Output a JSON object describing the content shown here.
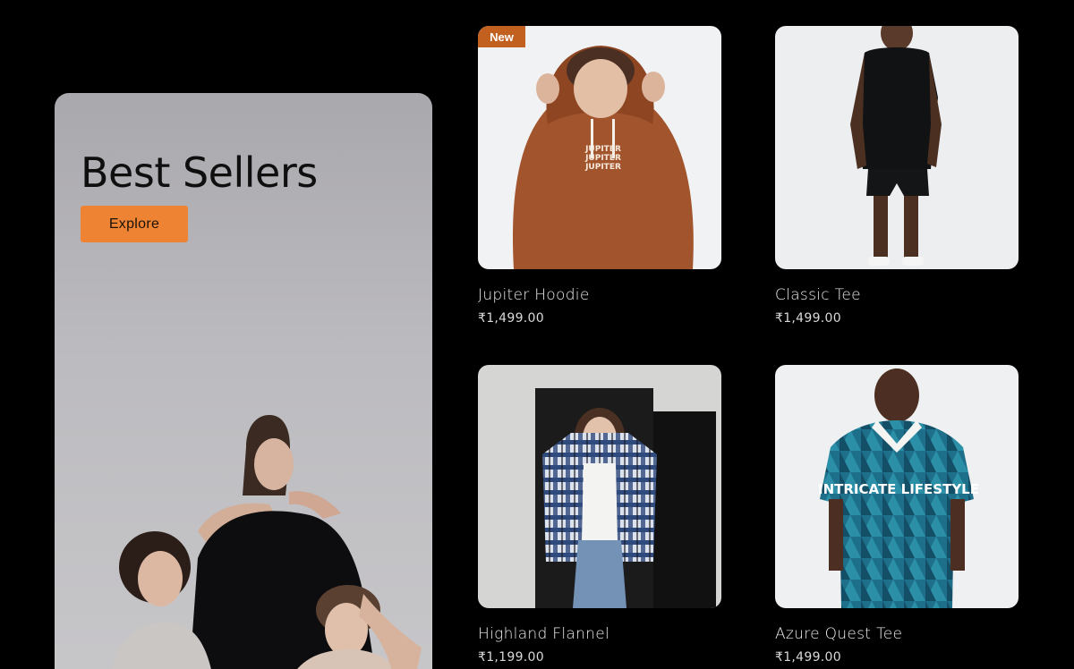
{
  "hero": {
    "title": "Best Sellers",
    "button_label": "Explore"
  },
  "products": [
    {
      "name": "Jupiter Hoodie",
      "price": "₹1,499.00",
      "badge": "New",
      "print": "JUPITER"
    },
    {
      "name": "Classic Tee",
      "price": "₹1,499.00"
    },
    {
      "name": "Highland Flannel",
      "price": "₹1,199.00"
    },
    {
      "name": "Azure Quest Tee",
      "price": "₹1,499.00",
      "print": "INTRICATE LIFESTYLE"
    }
  ],
  "colors": {
    "background": "#000000",
    "accent": "#ee8433",
    "badge": "#c2601f"
  }
}
